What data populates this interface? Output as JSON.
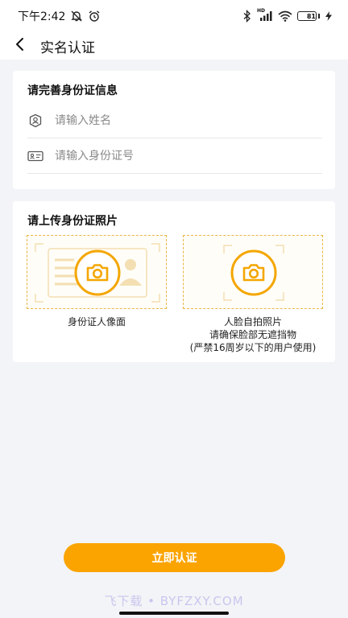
{
  "status_bar": {
    "time": "下午2:42",
    "battery_level": "81",
    "network_label": "HD",
    "battery_color": "#43c93e",
    "icons": [
      "mute-bell-icon",
      "alarm-icon",
      "bluetooth-icon",
      "signal-icon",
      "wifi-icon",
      "battery-icon",
      "charging-icon"
    ]
  },
  "nav": {
    "title": "实名认证",
    "back_icon": "chevron-left-icon"
  },
  "info_section": {
    "title": "请完善身份证信息",
    "name_field": {
      "placeholder": "请输入姓名",
      "value": "",
      "icon": "user-shield-icon"
    },
    "id_field": {
      "placeholder": "请输入身份证号",
      "value": "",
      "icon": "id-card-icon"
    }
  },
  "photo_section": {
    "title": "请上传身份证照片",
    "id_front": {
      "label": "身份证人像面",
      "icon": "camera-icon"
    },
    "face": {
      "label_line1": "人脸自拍照片",
      "label_line2": "请确保脸部无遮挡物",
      "label_line3": "(严禁16周岁以下的用户使用)",
      "icon": "camera-icon"
    }
  },
  "submit": {
    "label": "立即认证"
  },
  "watermark": "飞下载 • BYFZXY.COM",
  "colors": {
    "accent": "#fba400",
    "dashed_border": "#e9b646",
    "page_background": "#f3f4f7"
  }
}
